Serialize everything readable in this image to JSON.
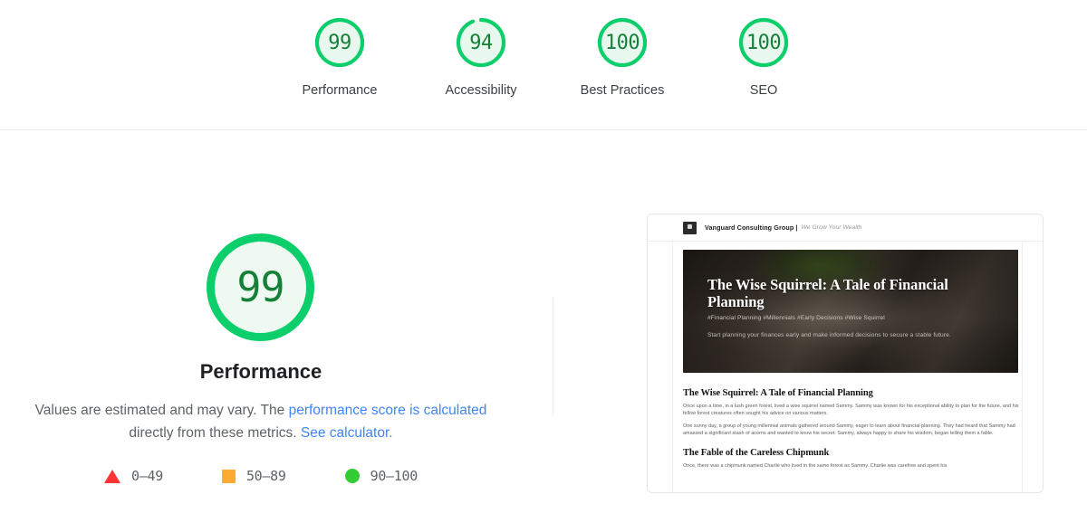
{
  "category_scores": [
    {
      "label": "Performance",
      "score": 99,
      "pct": 99,
      "color": "#0cce6b",
      "text_color": "#178038",
      "bg": "#e8f8ef"
    },
    {
      "label": "Accessibility",
      "score": 94,
      "pct": 94,
      "color": "#0cce6b",
      "text_color": "#178038",
      "bg": "#e8f8ef"
    },
    {
      "label": "Best Practices",
      "score": 100,
      "pct": 100,
      "color": "#0cce6b",
      "text_color": "#178038",
      "bg": "#e8f8ef"
    },
    {
      "label": "SEO",
      "score": 100,
      "pct": 100,
      "color": "#0cce6b",
      "text_color": "#178038",
      "bg": "#e8f8ef"
    }
  ],
  "performance_panel": {
    "score": 99,
    "title": "Performance",
    "disclaimer_before": "Values are estimated and may vary. The ",
    "link_calculated": "performance score is calculated",
    "disclaimer_middle": "directly from these metrics. ",
    "link_see_calculator": "See calculator.",
    "gauge_color": "#0cce6b",
    "gauge_text_color": "#178038",
    "gauge_bg": "#eef9f2"
  },
  "legend": [
    {
      "shape": "triangle-icon",
      "range": "0–49",
      "color": "#ff3333"
    },
    {
      "shape": "square-icon",
      "range": "50–89",
      "color": "#ffaa33"
    },
    {
      "shape": "circle-icon",
      "range": "90–100",
      "color": "#33cc33"
    }
  ],
  "screenshot": {
    "site_brand": "Vanguard Consulting Group |",
    "site_tagline": "We Grow Your Wealth",
    "hero_title": "The Wise Squirrel: A Tale of Financial Planning",
    "hero_tags": "#Financial Planning #Millennials #Early Decisions #Wise Squirrel",
    "hero_sub": "Start planning your finances early and make informed decisions to secure a stable future.",
    "article_heading_1": "The Wise Squirrel: A Tale of Financial Planning",
    "article_p1": "Once upon a time, in a lush green forest, lived a wise squirrel named Sammy. Sammy was known for his exceptional ability to plan for the future, and his fellow forest creatures often sought his advice on various matters.",
    "article_p2": "One sunny day, a group of young millennial animals gathered around Sammy, eager to learn about financial planning. They had heard that Sammy had amassed a significant stash of acorns and wanted to know his secret. Sammy, always happy to share his wisdom, began telling them a fable.",
    "article_heading_2": "The Fable of the Careless Chipmunk",
    "article_p3": "Once, there was a chipmunk named Charlie who lived in the same forest as Sammy. Charlie was carefree and spent his"
  }
}
